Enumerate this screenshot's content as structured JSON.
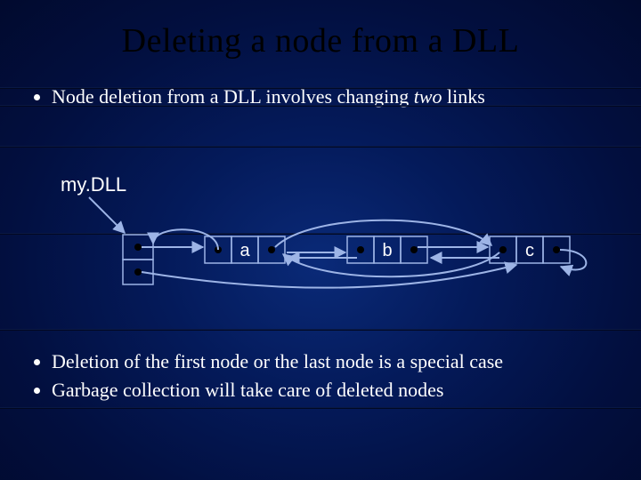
{
  "title": "Deleting a node from a DLL",
  "bullet_top": {
    "pre": "Node deletion from a DLL involves changing ",
    "italic": "two",
    "post": " links"
  },
  "mydll_label": "my.DLL",
  "nodes": {
    "a": "a",
    "b": "b",
    "c": "c"
  },
  "bullets_bottom": [
    "Deletion of the first node or the last node is a special case",
    "Garbage collection will take care of deleted nodes"
  ]
}
